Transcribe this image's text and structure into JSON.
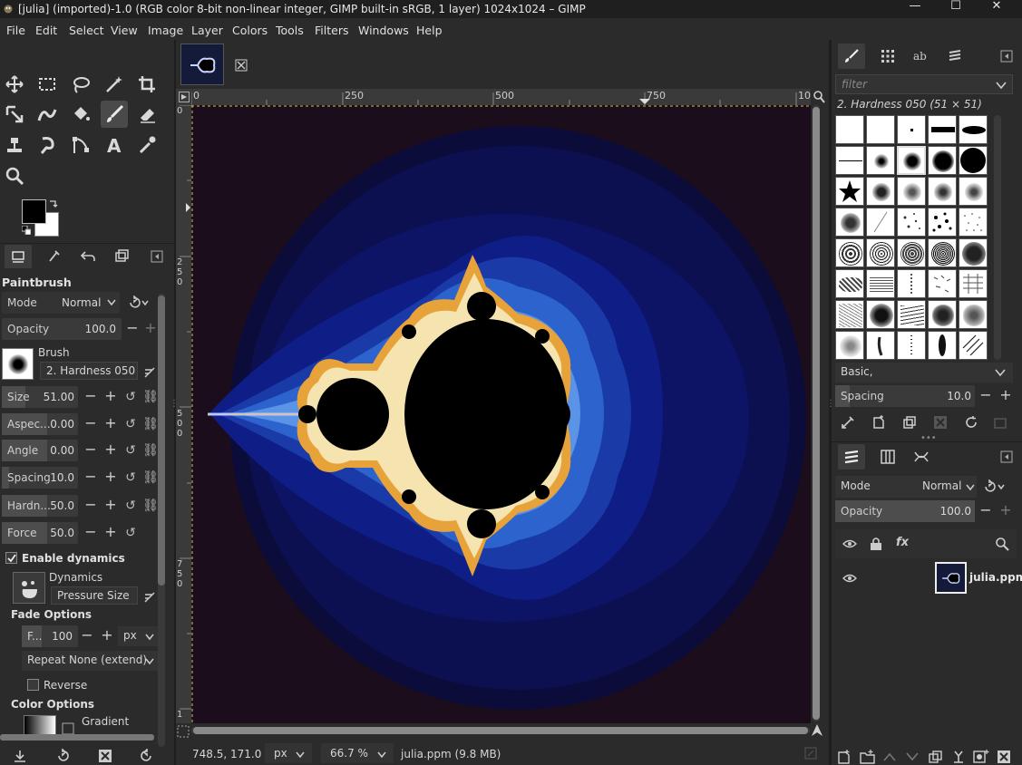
{
  "window": {
    "title": "[julia] (imported)-1.0 (RGB color 8-bit non-linear integer, GIMP built-in sRGB, 1 layer) 1024x1024 – GIMP",
    "minimize": "—",
    "maximize": "☐",
    "close": "✕"
  },
  "menu": [
    "File",
    "Edit",
    "Select",
    "View",
    "Image",
    "Layer",
    "Colors",
    "Tools",
    "Filters",
    "Windows",
    "Help"
  ],
  "tool_options": {
    "title": "Paintbrush",
    "mode_label": "Mode",
    "mode_value": "Normal",
    "opacity_label": "Opacity",
    "opacity_value": "100.0",
    "brush_label": "Brush",
    "brush_value": "2. Hardness 050",
    "size_label": "Size",
    "size_value": "51.00",
    "aspect_label": "Aspec...",
    "aspect_value": "0.00",
    "angle_label": "Angle",
    "angle_value": "0.00",
    "spacing_label": "Spacing",
    "spacing_value": "10.0",
    "hardness_label": "Hardn...",
    "hardness_value": "50.0",
    "force_label": "Force",
    "force_value": "50.0",
    "enable_dynamics": "Enable dynamics",
    "dynamics_label": "Dynamics",
    "dynamics_value": "Pressure Size",
    "fade_options": "Fade Options",
    "fade_label": "F...",
    "fade_value": "100",
    "fade_unit": "px",
    "repeat_label": "Repeat",
    "repeat_value": "None (extend)",
    "reverse_label": "Reverse",
    "color_options": "Color Options",
    "gradient_label": "Gradient"
  },
  "rulers": {
    "top": [
      "0",
      "250",
      "500",
      "750",
      "10"
    ],
    "left": [
      "0",
      "2\n5\n0",
      "5\n0\n0",
      "7\n5\n0",
      "1"
    ]
  },
  "status": {
    "coords": "748.5, 171.0",
    "unit": "px",
    "zoom": "66.7 %",
    "file": "julia.ppm (9.8 MB)"
  },
  "brushes": {
    "filter_placeholder": "filter",
    "current": "2. Hardness 050 (51 × 51)",
    "tag": "Basic,",
    "spacing_label": "Spacing",
    "spacing_value": "10.0"
  },
  "layers": {
    "mode_label": "Mode",
    "mode_value": "Normal",
    "opacity_label": "Opacity",
    "opacity_value": "100.0",
    "layer_name": "julia.ppm"
  }
}
